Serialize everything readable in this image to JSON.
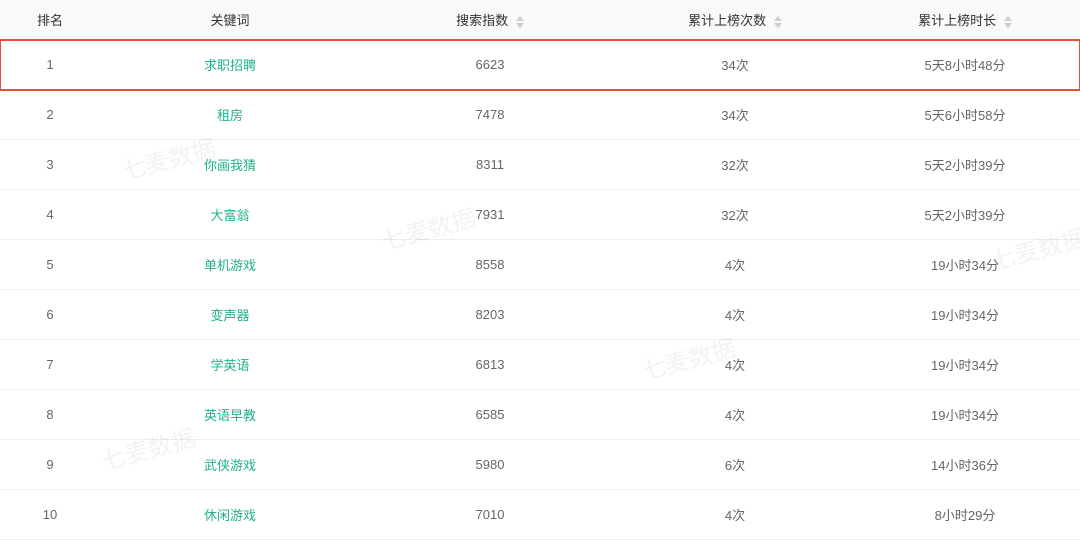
{
  "watermark_text": "七麦数据",
  "table": {
    "headers": {
      "rank": "排名",
      "keyword": "关键词",
      "search_index": "搜索指数",
      "rank_count": "累计上榜次数",
      "rank_duration": "累计上榜时长"
    },
    "rows": [
      {
        "rank": "1",
        "keyword": "求职招聘",
        "search_index": "6623",
        "rank_count": "34次",
        "rank_duration": "5天8小时48分",
        "highlighted": true
      },
      {
        "rank": "2",
        "keyword": "租房",
        "search_index": "7478",
        "rank_count": "34次",
        "rank_duration": "5天6小时58分",
        "highlighted": false
      },
      {
        "rank": "3",
        "keyword": "你画我猜",
        "search_index": "8311",
        "rank_count": "32次",
        "rank_duration": "5天2小时39分",
        "highlighted": false
      },
      {
        "rank": "4",
        "keyword": "大富翁",
        "search_index": "7931",
        "rank_count": "32次",
        "rank_duration": "5天2小时39分",
        "highlighted": false
      },
      {
        "rank": "5",
        "keyword": "单机游戏",
        "search_index": "8558",
        "rank_count": "4次",
        "rank_duration": "19小时34分",
        "highlighted": false
      },
      {
        "rank": "6",
        "keyword": "变声器",
        "search_index": "8203",
        "rank_count": "4次",
        "rank_duration": "19小时34分",
        "highlighted": false
      },
      {
        "rank": "7",
        "keyword": "学英语",
        "search_index": "6813",
        "rank_count": "4次",
        "rank_duration": "19小时34分",
        "highlighted": false
      },
      {
        "rank": "8",
        "keyword": "英语早教",
        "search_index": "6585",
        "rank_count": "4次",
        "rank_duration": "19小时34分",
        "highlighted": false
      },
      {
        "rank": "9",
        "keyword": "武侠游戏",
        "search_index": "5980",
        "rank_count": "6次",
        "rank_duration": "14小时36分",
        "highlighted": false
      },
      {
        "rank": "10",
        "keyword": "休闲游戏",
        "search_index": "7010",
        "rank_count": "4次",
        "rank_duration": "8小时29分",
        "highlighted": false
      }
    ]
  }
}
